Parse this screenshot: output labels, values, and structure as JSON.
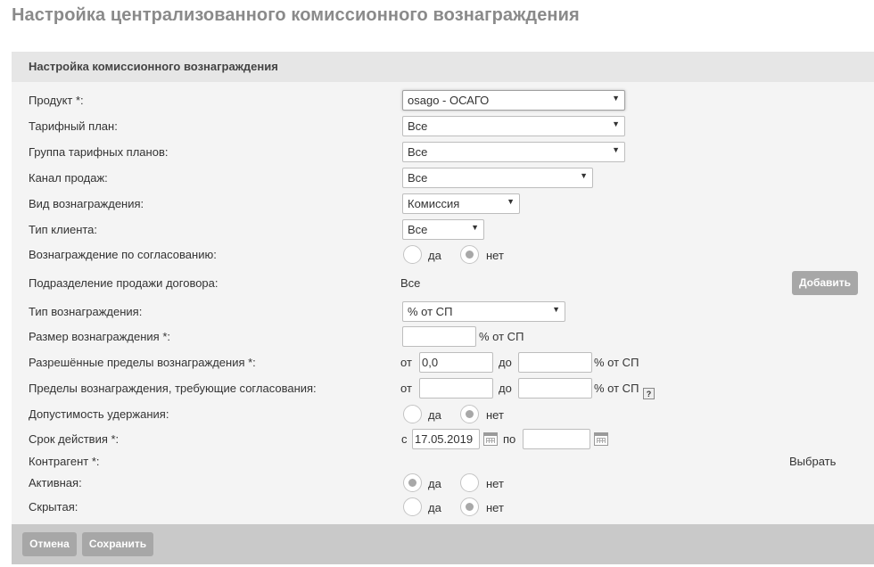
{
  "page": {
    "title": "Настройка централизованного комиссионного вознаграждения"
  },
  "panel": {
    "header": "Настройка комиссионного вознаграждения"
  },
  "form": {
    "product": {
      "label": "Продукт *:",
      "value": "osago - ОСАГО"
    },
    "tariff_plan": {
      "label": "Тарифный план:",
      "value": "Все"
    },
    "tariff_group": {
      "label": "Группа тарифных планов:",
      "value": "Все"
    },
    "sales_channel": {
      "label": "Канал продаж:",
      "value": "Все"
    },
    "reward_kind": {
      "label": "Вид вознаграждения:",
      "value": "Комиссия"
    },
    "client_type": {
      "label": "Тип клиента:",
      "value": "Все"
    },
    "reward_by_approval": {
      "label": "Вознаграждение по согласованию:",
      "yes": "да",
      "no": "нет",
      "selected": "нет"
    },
    "division": {
      "label": "Подразделение продажи договора:",
      "value": "Все",
      "add_button": "Добавить"
    },
    "reward_type": {
      "label": "Тип вознаграждения:",
      "value": "% от СП"
    },
    "reward_size": {
      "label": "Размер вознаграждения *:",
      "value": "",
      "unit": "% от СП"
    },
    "allowed_limits": {
      "label": "Разрешённые пределы вознаграждения *:",
      "from_label": "от",
      "from_value": "0,0",
      "to_label": "до",
      "to_value": "",
      "unit": "% от СП"
    },
    "approval_limits": {
      "label": "Пределы вознаграждения, требующие согласования:",
      "from_label": "от",
      "from_value": "",
      "to_label": "до",
      "to_value": "",
      "unit": "% от СП",
      "help": "?"
    },
    "withholding": {
      "label": "Допустимость удержания:",
      "yes": "да",
      "no": "нет",
      "selected": "нет"
    },
    "validity": {
      "label": "Срок действия *:",
      "from_label": "с",
      "from_value": "17.05.2019",
      "to_label": "по",
      "to_value": ""
    },
    "counterparty": {
      "label": "Контрагент *:",
      "select_link": "Выбрать"
    },
    "active": {
      "label": "Активная:",
      "yes": "да",
      "no": "нет",
      "selected": "да"
    },
    "hidden": {
      "label": "Скрытая:",
      "yes": "да",
      "no": "нет",
      "selected": "нет"
    }
  },
  "footer": {
    "cancel": "Отмена",
    "save": "Сохранить"
  },
  "icons": {
    "dropdown": "chevron-down-icon",
    "calendar": "calendar-icon",
    "help": "help-icon"
  }
}
